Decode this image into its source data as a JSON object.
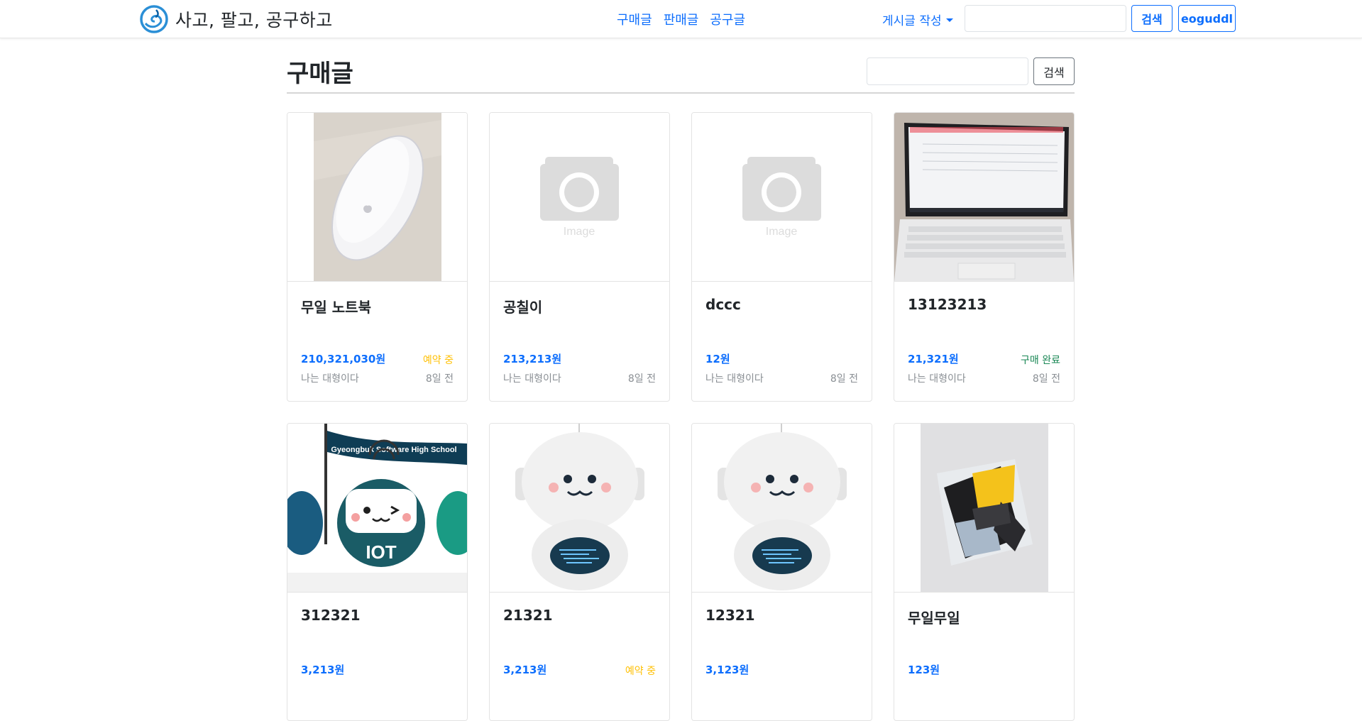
{
  "navbar": {
    "brand": "사고, 팔고, 공구하고",
    "links": [
      "구매글",
      "판매글",
      "공구글"
    ],
    "write_menu": "게시글 작성",
    "search_placeholder": "",
    "search_button": "검색",
    "user_button": "eoguddl"
  },
  "page": {
    "title": "구매글",
    "search_placeholder": "",
    "search_button": "검색"
  },
  "cards": [
    {
      "title": "무일 노트북",
      "price": "210,321,030원",
      "status": "예약 중",
      "status_type": "reserved",
      "author": "나는 대형이다",
      "time": "8일 전",
      "image": "mouse-photo"
    },
    {
      "title": "공칠이",
      "price": "213,213원",
      "status": "",
      "status_type": "",
      "author": "나는 대형이다",
      "time": "8일 전",
      "image": "placeholder-image"
    },
    {
      "title": "dccc",
      "price": "12원",
      "status": "",
      "status_type": "",
      "author": "나는 대형이다",
      "time": "8일 전",
      "image": "placeholder-image"
    },
    {
      "title": "13123213",
      "price": "21,321원",
      "status": "구매 완료",
      "status_type": "done",
      "author": "나는 대형이다",
      "time": "8일 전",
      "image": "laptop-photo"
    },
    {
      "title": "312321",
      "price": "3,213원",
      "status": "",
      "status_type": "",
      "author": "",
      "time": "",
      "image": "iot-mascot-banner"
    },
    {
      "title": "21321",
      "price": "3,213원",
      "status": "예약 중",
      "status_type": "reserved",
      "author": "",
      "time": "",
      "image": "robot-mascot"
    },
    {
      "title": "12321",
      "price": "3,123원",
      "status": "",
      "status_type": "",
      "author": "",
      "time": "",
      "image": "robot-mascot"
    },
    {
      "title": "무일무일",
      "price": "123원",
      "status": "",
      "status_type": "",
      "author": "",
      "time": "",
      "image": "rice-ball-photo"
    }
  ],
  "placeholder_label": "Image",
  "banner_text": "Gyeongbuk Software High School",
  "banner_logo": "IOT",
  "colors": {
    "primary": "#0d6efd",
    "reserved": "#ffc107",
    "done": "#198754"
  }
}
